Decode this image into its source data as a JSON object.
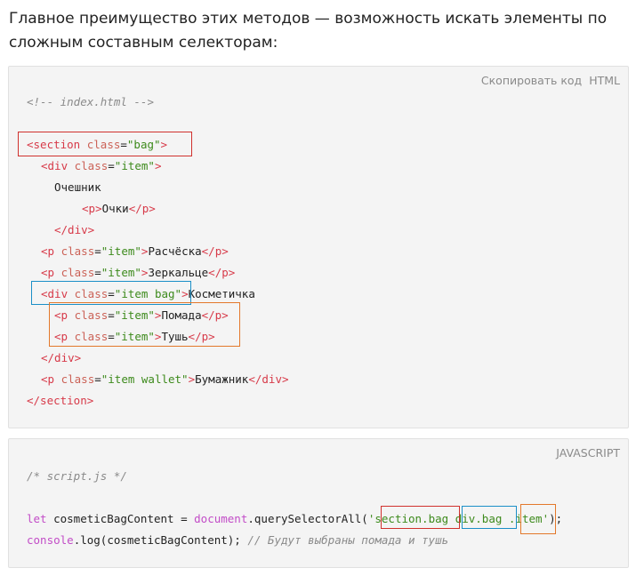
{
  "intro": {
    "line1": "Главное преимущество этих методов — возможность искать элементы по",
    "line2": "сложным составным селекторам:"
  },
  "html_block": {
    "copy_label": "Скопировать код",
    "lang": "HTML",
    "comment": "<!-- index.html -->",
    "lines": {
      "l1_open": "<section",
      "l1_attr": " class",
      "l1_eq": "=",
      "l1_val": "\"bag\"",
      "l1_close": ">",
      "l2_open": "<div",
      "l2_attr": " class",
      "l2_eq": "=",
      "l2_val": "\"item\"",
      "l2_close": ">",
      "l3_text": "Очешник",
      "l4_open": "<p",
      "l4_close": ">",
      "l4_text": "Очки",
      "l4_end": "</p>",
      "l5_end": "</div>",
      "l6_open": "<p",
      "l6_attr": " class",
      "l6_eq": "=",
      "l6_val": "\"item\"",
      "l6_close": ">",
      "l6_text": "Расчёска",
      "l6_end": "</p>",
      "l7_open": "<p",
      "l7_attr": " class",
      "l7_eq": "=",
      "l7_val": "\"item\"",
      "l7_close": ">",
      "l7_text": "Зеркальце",
      "l7_end": "</p>",
      "l8_open": "<div",
      "l8_attr": " class",
      "l8_eq": "=",
      "l8_val": "\"item bag\"",
      "l8_close": ">",
      "l8_text": "Косметичка",
      "l9_open": "<p",
      "l9_attr": " class",
      "l9_eq": "=",
      "l9_val": "\"item\"",
      "l9_close": ">",
      "l9_text": "Помада",
      "l9_end": "</p>",
      "l10_open": "<p",
      "l10_attr": " class",
      "l10_eq": "=",
      "l10_val": "\"item\"",
      "l10_close": ">",
      "l10_text": "Тушь",
      "l10_end": "</p>",
      "l11_end": "</div>",
      "l12_open": "<p",
      "l12_attr": " class",
      "l12_eq": "=",
      "l12_val": "\"item wallet\"",
      "l12_close": ">",
      "l12_text": "Бумажник",
      "l12_end": "</div>",
      "l13_end": "</section>"
    }
  },
  "js_block": {
    "lang": "JAVASCRIPT",
    "comment": "/* script.js */",
    "let_kw": "let",
    "var_decl": " cosmeticBagContent = ",
    "doc": "document",
    "method": ".querySelectorAll(",
    "q_open": "'",
    "sel1": "section.bag",
    "sp1": " ",
    "sel2": "div.bag",
    "sp2": " ",
    "sel3": ".item",
    "q_close": "'",
    "end1": ");",
    "console_kw": "console",
    "log_call": ".log(cosmeticBagContent); ",
    "line_comment": "// Будут выбраны помада и тушь"
  },
  "colors": {
    "tag": "#d73a49",
    "string": "#3d8a1c",
    "keyword": "#c24cc7",
    "comment": "#8a8a8a",
    "highlight_red": "#d0312d",
    "highlight_blue": "#1b8fc7",
    "highlight_orange": "#e3782b"
  }
}
